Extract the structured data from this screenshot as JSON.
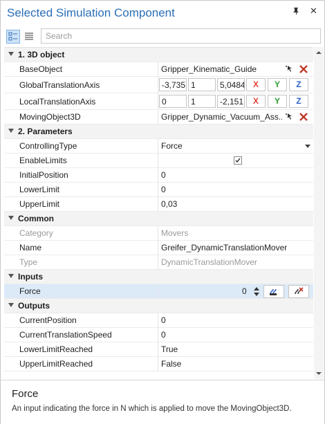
{
  "window": {
    "title": "Selected Simulation Component",
    "pin_glyph": "⚑",
    "close_glyph": "✕"
  },
  "toolbar": {
    "categorized_icon": "categorized-view-icon",
    "alphabetical_icon": "alphabetical-view-icon",
    "search_placeholder": "Search"
  },
  "categories": {
    "c1": "1. 3D object",
    "c2": "2. Parameters",
    "c3": "Common",
    "c4": "Inputs",
    "c5": "Outputs"
  },
  "props": {
    "base_object": {
      "name": "BaseObject",
      "value": "Gripper_Kinematic_Guide"
    },
    "global_axis": {
      "name": "GlobalTranslationAxis",
      "x": "-3,735",
      "y": "1",
      "z": "5,0484",
      "bx": "X",
      "by": "Y",
      "bz": "Z"
    },
    "local_axis": {
      "name": "LocalTranslationAxis",
      "x": "0",
      "y": "1",
      "z": "-2,151",
      "bx": "X",
      "by": "Y",
      "bz": "Z"
    },
    "moving_object": {
      "name": "MovingObject3D",
      "value": "Gripper_Dynamic_Vacuum_Ass..."
    },
    "controlling_type": {
      "name": "ControllingType",
      "value": "Force"
    },
    "enable_limits": {
      "name": "EnableLimits",
      "checked": true
    },
    "initial_position": {
      "name": "InitialPosition",
      "value": "0"
    },
    "lower_limit": {
      "name": "LowerLimit",
      "value": "0"
    },
    "upper_limit": {
      "name": "UpperLimit",
      "value": "0,03"
    },
    "category": {
      "name": "Category",
      "value": "Movers"
    },
    "pname": {
      "name": "Name",
      "value": "Greifer_DynamicTranslationMover"
    },
    "ptype": {
      "name": "Type",
      "value": "DynamicTranslationMover"
    },
    "force": {
      "name": "Force",
      "value": "0"
    },
    "current_position": {
      "name": "CurrentPosition",
      "value": "0"
    },
    "current_speed": {
      "name": "CurrentTranslationSpeed",
      "value": "0"
    },
    "lower_reached": {
      "name": "LowerLimitReached",
      "value": "True"
    },
    "upper_reached": {
      "name": "UpperLimitReached",
      "value": "False"
    }
  },
  "description": {
    "title": "Force",
    "text": "An input indicating the force in N which is applied to move the MovingObject3D."
  },
  "colors": {
    "accent": "#2b6fb6",
    "axis_x": "#e0413a",
    "axis_y": "#2f9d32",
    "axis_z": "#2c62c8",
    "selected_row": "#dceaf8"
  }
}
